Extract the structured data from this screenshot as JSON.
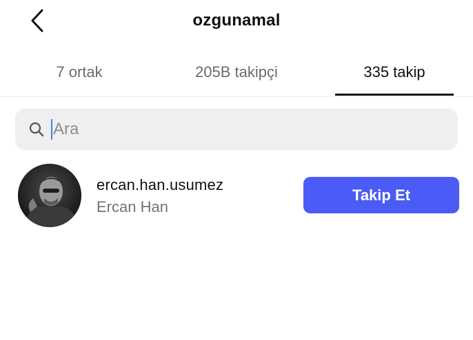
{
  "header": {
    "title": "ozgunamal",
    "back_icon": "chevron-left-icon"
  },
  "tabs": [
    {
      "label": "7 ortak",
      "active": false
    },
    {
      "label": "205B takipçi",
      "active": false
    },
    {
      "label": "335 takip",
      "active": true
    }
  ],
  "search": {
    "placeholder": "Ara",
    "icon": "search-icon"
  },
  "list": [
    {
      "username": "ercan.han.usumez",
      "full_name": "Ercan Han",
      "button_label": "Takip Et"
    }
  ],
  "colors": {
    "accent": "#4a5cf5",
    "caret": "#3b82f6",
    "search_bg": "#efefef",
    "muted_text": "#737373"
  }
}
